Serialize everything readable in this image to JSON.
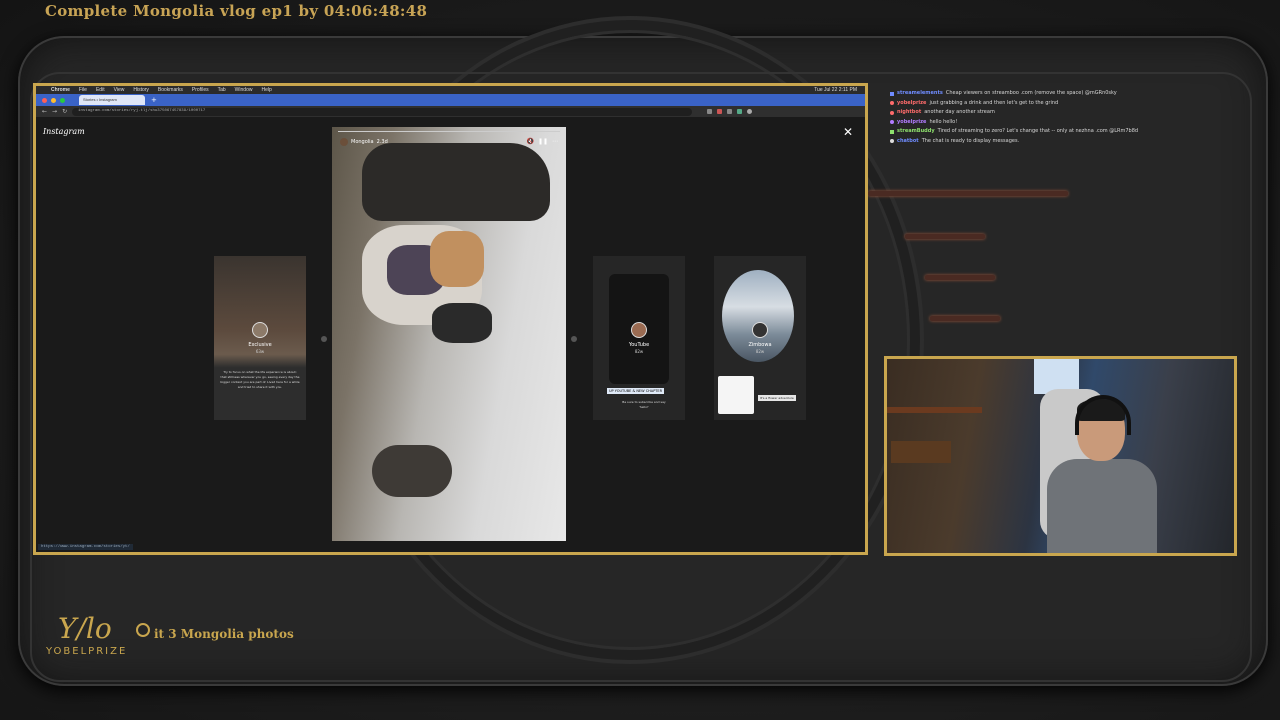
{
  "stream": {
    "title": "Complete Mongolia vlog ep1 by 04:06:48:48",
    "task": "it 3 Mongolia photos",
    "brand": "YOBELPRIZE"
  },
  "colors": {
    "frame_gold": "#c9a64e",
    "tab_bar": "#3a63c7",
    "background": "#1c1c1c"
  },
  "mac_menu": {
    "apple": "",
    "items": [
      "Chrome",
      "File",
      "Edit",
      "View",
      "History",
      "Bookmarks",
      "Profiles",
      "Tab",
      "Window",
      "Help"
    ],
    "clock": "Tue Jul 22  2:11 PM"
  },
  "browser": {
    "tab_title": "Stories • Instagram",
    "url": "instagram.com/stories/ryj.tlj/shu375067457839/1000717",
    "status_url": "https://www.instagram.com/stories/yt/"
  },
  "instagram": {
    "logo": "Instagram",
    "close_icon": "close-icon",
    "main_story": {
      "username": "Mongolia",
      "age": "2.3d"
    },
    "cards": [
      {
        "name": "Exclusive",
        "age": "63w",
        "blurb": "Try to focus on what the life experience is about; that stillness wherever you go, seeing every day the bigger context you are part of. Lived here for a while and tried to share it with you."
      },
      {
        "name": "YouTube",
        "age": "82w",
        "cta": "UP YOUTUBE & NEW CHAPTER",
        "cta_sub": "Be sure to subscribe and say 'hello!'"
      },
      {
        "name": "Zimbowa",
        "age": "82w",
        "tip": "It's a flower adventure"
      }
    ]
  },
  "chat": [
    {
      "user": "streamelements",
      "color": "#6f8cff",
      "text": "Cheap viewers on streamboo .com (remove the space) @mGRn0sky"
    },
    {
      "user": "yobelprize",
      "color": "#ff6b6b",
      "text": "just grabbing a drink and then let's get to the grind"
    },
    {
      "user": "nightbot",
      "color": "#ff6b6b",
      "text": "another day another stream"
    },
    {
      "user": "yobelprize",
      "color": "#b27cff",
      "text": "hello hello!"
    },
    {
      "user": "streamBuddy",
      "color": "#8ee06d",
      "text": "Tired of streaming to zero? Let's change that -- only at nezhna .com @LRm7b8d"
    },
    {
      "user": "chatbot",
      "color": "#6f8cff",
      "text": "The chat is ready to display messages."
    }
  ]
}
